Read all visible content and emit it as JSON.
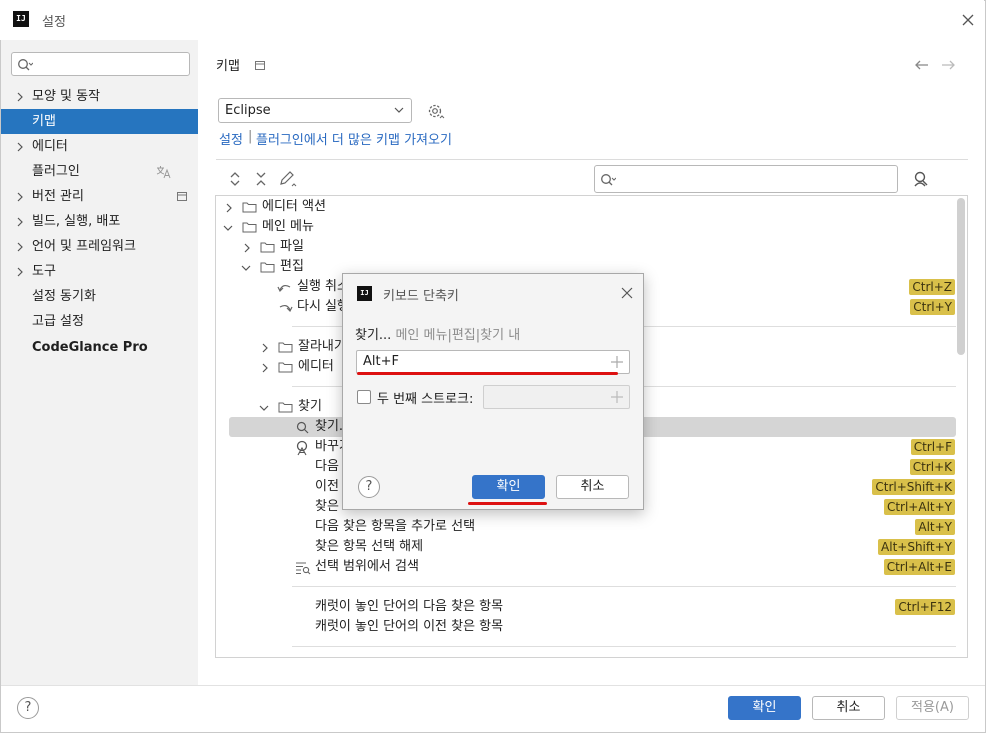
{
  "window": {
    "title": "설정",
    "app_icon_text": "IJ"
  },
  "sidebar": {
    "search_placeholder": "",
    "items": [
      {
        "label": "모양 및 동작",
        "expandable": true
      },
      {
        "label": "키맵",
        "selected": true
      },
      {
        "label": "에디터",
        "expandable": true
      },
      {
        "label": "플러그인"
      },
      {
        "label": "버전 관리",
        "expandable": true
      },
      {
        "label": "빌드, 실행, 배포",
        "expandable": true
      },
      {
        "label": "언어 및 프레임워크",
        "expandable": true
      },
      {
        "label": "도구",
        "expandable": true
      },
      {
        "label": "설정 동기화"
      },
      {
        "label": "고급 설정"
      },
      {
        "label": "CodeGlance Pro"
      }
    ]
  },
  "header": {
    "title": "키맵"
  },
  "keymap": {
    "selected": "Eclipse",
    "link_settings": "설정",
    "link_separator": "|",
    "link_plugins": "플러그인에서 더 많은 키맵 가져오기"
  },
  "tree": {
    "rows": [
      {
        "label": "에디터 액션"
      },
      {
        "label": "메인 메뉴"
      },
      {
        "label": "파일"
      },
      {
        "label": "편집"
      },
      {
        "label": "실행 취소",
        "shortcut": "Ctrl+Z"
      },
      {
        "label": "다시 실행",
        "shortcut": "Ctrl+Y"
      },
      {
        "label": "잘라내기"
      },
      {
        "label": "에디터"
      },
      {
        "label": "찾기"
      },
      {
        "label": "찾기..."
      },
      {
        "label": "바꾸기",
        "shortcut": "Ctrl+F"
      },
      {
        "label": "다음",
        "shortcut": "Ctrl+K"
      },
      {
        "label": "이전",
        "shortcut": "Ctrl+Shift+K"
      },
      {
        "label": "찾은",
        "shortcut": "Ctrl+Alt+Y"
      },
      {
        "label": "다음 찾은 항목을 추가로 선택",
        "shortcut": "Alt+Y"
      },
      {
        "label": "찾은 항목 선택 해제",
        "shortcut": "Alt+Shift+Y"
      },
      {
        "label": "선택 범위에서 검색",
        "shortcut": "Ctrl+Alt+E"
      },
      {
        "label": "캐럿이 놓인 단어의 다음 찾은 항목",
        "shortcut": "Ctrl+F12"
      },
      {
        "label": "캐럿이 놓인 단어의 이전 찾은 항목"
      }
    ]
  },
  "dialog": {
    "title": "키보드 단축키",
    "icon_text": "IJ",
    "path_first": "찾기...",
    "path_parts": [
      "메인 메뉴",
      "|",
      "편집",
      "|",
      "찾기 내"
    ],
    "shortcut_value": "Alt+F",
    "second_stroke_label": "두 번째 스트로크:",
    "second_stroke_value": "",
    "help": "?",
    "ok": "확인",
    "cancel": "취소"
  },
  "footer": {
    "help": "?",
    "ok": "확인",
    "cancel": "취소",
    "apply": "적용(A)"
  },
  "colors": {
    "accent": "#3574c9",
    "selection": "#2675bf",
    "shortcut_badge": "#d9c04a",
    "annotation_red": "#dd1111"
  }
}
